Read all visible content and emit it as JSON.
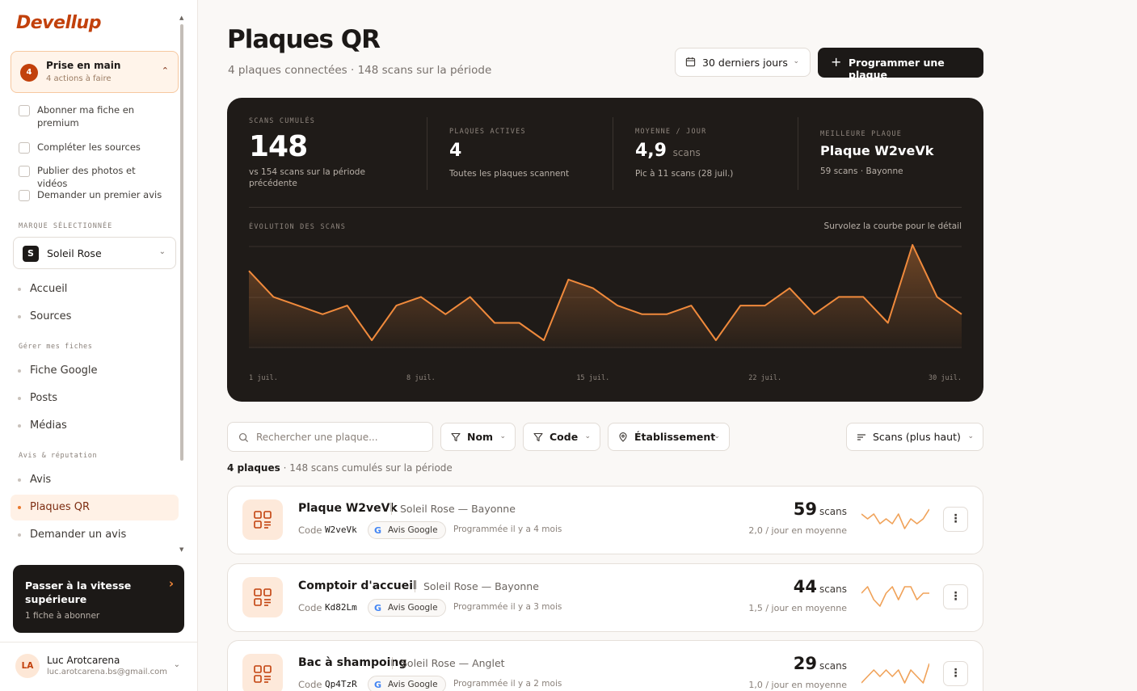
{
  "app": {
    "logo": "Devellup"
  },
  "onboarding": {
    "count": "4",
    "title": "Prise en main",
    "subtitle": "4 actions à faire"
  },
  "todos": [
    {
      "label": "Abonner ma fiche en premium"
    },
    {
      "label": "Compléter les sources"
    },
    {
      "label": "Publier des photos et vidéos"
    },
    {
      "label": "Demander un premier avis"
    }
  ],
  "brand": {
    "section_label": "MARQUE SÉLECTIONNÉE",
    "initial": "S",
    "name": "Soleil Rose"
  },
  "nav": {
    "top": [
      {
        "label": "Accueil"
      },
      {
        "label": "Sources"
      }
    ],
    "section1": "Gérer mes fiches",
    "group1": [
      {
        "label": "Fiche Google"
      },
      {
        "label": "Posts"
      },
      {
        "label": "Médias"
      }
    ],
    "section2": "Avis & réputation",
    "group2": [
      {
        "label": "Avis"
      },
      {
        "label": "Plaques QR"
      },
      {
        "label": "Demander un avis"
      }
    ],
    "active": "Plaques QR"
  },
  "upgrade": {
    "title": "Passer à la vitesse supérieure",
    "subtitle": "1 fiche à abonner"
  },
  "user": {
    "initials": "LA",
    "name": "Luc Arotcarena",
    "email": "luc.arotcarena.bs@gmail.com"
  },
  "header": {
    "title": "Plaques QR",
    "subtitle": "4 plaques connectées · 148 scans sur la période",
    "period": "30 derniers jours",
    "primary_action": "Programmer une plaque"
  },
  "kpis": {
    "cumulative": {
      "label": "SCANS CUMULÉS",
      "value": "148",
      "desc": "vs 154 scans sur la période précédente"
    },
    "active": {
      "label": "PLAQUES ACTIVES",
      "value": "4",
      "desc": "Toutes les plaques scannent"
    },
    "average": {
      "label": "MOYENNE / JOUR",
      "value": "4,9",
      "unit": "scans",
      "desc": "Pic à 11 scans (28 juil.)"
    },
    "best": {
      "label": "MEILLEURE PLAQUE",
      "value": "Plaque W2veVk",
      "desc": "59 scans · Bayonne"
    }
  },
  "chart_data": {
    "type": "area",
    "title": "ÉVOLUTION DES SCANS",
    "hint": "Survolez la courbe pour le détail",
    "x": [
      "1 juil.",
      "2 juil.",
      "3 juil.",
      "4 juil.",
      "5 juil.",
      "6 juil.",
      "7 juil.",
      "8 juil.",
      "9 juil.",
      "10 juil.",
      "11 juil.",
      "12 juil.",
      "13 juil.",
      "14 juil.",
      "15 juil.",
      "16 juil.",
      "17 juil.",
      "18 juil.",
      "19 juil.",
      "20 juil.",
      "21 juil.",
      "22 juil.",
      "23 juil.",
      "24 juil.",
      "25 juil.",
      "26 juil.",
      "27 juil.",
      "28 juil.",
      "29 juil.",
      "30 juil."
    ],
    "x_tick_labels": [
      "1 juil.",
      "8 juil.",
      "15 juil.",
      "22 juil.",
      "30 juil."
    ],
    "x_tick_index": [
      0,
      7,
      14,
      21,
      29
    ],
    "values": [
      8,
      5,
      4,
      3,
      4,
      0,
      4,
      5,
      3,
      5,
      2,
      2,
      0,
      7,
      6,
      4,
      3,
      3,
      4,
      0,
      4,
      4,
      6,
      3,
      5,
      5,
      2,
      11,
      5,
      3
    ],
    "ylim": [
      0,
      11
    ],
    "grid": true,
    "line_color": "#f08a3c"
  },
  "filters": {
    "search_placeholder": "Rechercher une plaque...",
    "name": "Nom",
    "code": "Code",
    "place": "Établissement",
    "sort": "Scans (plus haut)"
  },
  "summary": {
    "count": "4 plaques",
    "rest": " · 148 scans cumulés sur la période"
  },
  "plates": [
    {
      "name": "Plaque W2veVk",
      "location": "Soleil Rose — Bayonne",
      "code_label": "Code",
      "code": "W2veVk",
      "source": "Avis Google",
      "scheduled": "Programmée il y a 4 mois",
      "scans": "59",
      "unit": "scans",
      "avg": "2,0 / jour en moyenne",
      "spark": [
        4,
        3,
        4,
        2,
        3,
        2,
        4,
        1,
        3,
        2,
        3,
        5
      ]
    },
    {
      "name": "Comptoir d'accueil",
      "location": "Soleil Rose — Bayonne",
      "code_label": "Code",
      "code": "Kd82Lm",
      "source": "Avis Google",
      "scheduled": "Programmée il y a 3 mois",
      "scans": "44",
      "unit": "scans",
      "avg": "1,5 / jour en moyenne",
      "spark": [
        3,
        4,
        2,
        1,
        3,
        4,
        2,
        4,
        4,
        2,
        3,
        3
      ]
    },
    {
      "name": "Bac à shampoing",
      "location": "Soleil Rose — Anglet",
      "code_label": "Code",
      "code": "Qp4TzR",
      "source": "Avis Google",
      "scheduled": "Programmée il y a 2 mois",
      "scans": "29",
      "unit": "scans",
      "avg": "1,0 / jour en moyenne",
      "spark": [
        1,
        2,
        3,
        2,
        3,
        2,
        3,
        1,
        3,
        2,
        1,
        4
      ]
    }
  ]
}
